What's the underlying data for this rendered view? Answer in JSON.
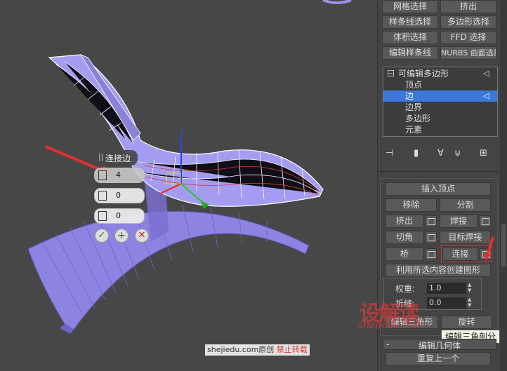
{
  "panel": {
    "modifier_buttons": [
      "网格选择",
      "挤出",
      "样条线选择",
      "多边形选择",
      "体积选择",
      "FFD 选择",
      "编辑样条线",
      "NURBS 曲面选择"
    ],
    "stack_items": [
      "可编辑多边形",
      "顶点",
      "边",
      "边界",
      "多边形",
      "元素"
    ],
    "edit_edges": {
      "insert_vertex": "插入顶点",
      "remove": "移除",
      "split": "分割",
      "extrude": "挤出",
      "weld": "焊接",
      "chamfer": "切角",
      "target_weld": "目标焊接",
      "bridge": "桥",
      "connect": "连接",
      "create_shape": "利用所选内容创建图形",
      "weight_label": "权重:",
      "weight_value": "1.0",
      "crease_label": "折缝:",
      "crease_value": "0.0",
      "edit_tri": "编辑三角形",
      "turn": "旋转"
    },
    "tooltip": "编辑三角剖分",
    "rollout_title": "编辑几何体",
    "rollout_minus": "-",
    "repeat_last": "重复上一个"
  },
  "caddy": {
    "title": "连接边",
    "segments": "4",
    "pinch": "0",
    "slide": "0"
  },
  "axis": {
    "z": "z"
  },
  "watermark": {
    "logo": "设解读",
    "site": "shejiedu.com",
    "footer_site": "shejiedu.com原创",
    "footer_warn": "禁止转载"
  },
  "colors": {
    "selected": "#3b78d8",
    "mesh": "#9a93e6",
    "highlight": "#d93838"
  }
}
